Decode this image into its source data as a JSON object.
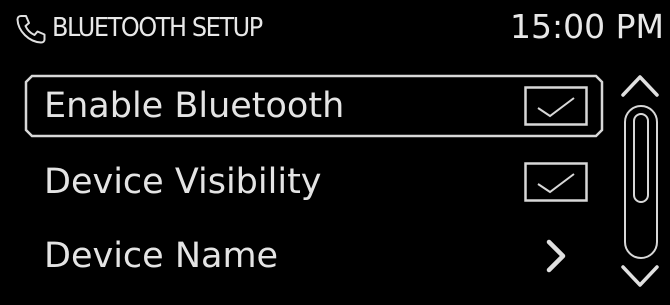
{
  "header": {
    "title": "BLUETOOTH SETUP",
    "time": "15:00 PM",
    "icon": "phone-icon"
  },
  "menu": {
    "items": [
      {
        "label": "Enable Bluetooth",
        "control": "checkbox",
        "checked": true,
        "selected": true
      },
      {
        "label": "Device Visibility",
        "control": "checkbox",
        "checked": true,
        "selected": false
      },
      {
        "label": "Device Name",
        "control": "chevron-right-icon",
        "selected": false
      }
    ]
  },
  "scrollbar": {
    "up_icon": "chevron-up-icon",
    "down_icon": "chevron-down-icon"
  },
  "colors": {
    "background": "#000000",
    "foreground": "#e6e6e6"
  }
}
